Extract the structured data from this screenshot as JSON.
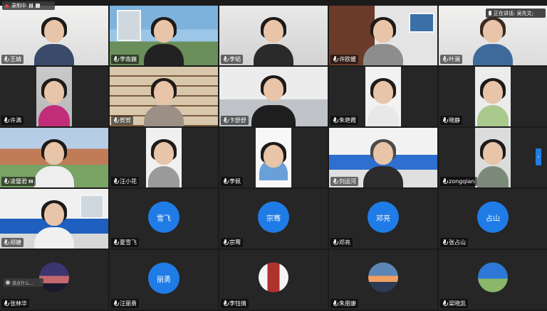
{
  "recording": {
    "label": "录制中"
  },
  "speaking": {
    "label": "正在讲话: 吴先文;"
  },
  "chat": {
    "placeholder": "说点什么..."
  },
  "colors": {
    "avatar_blue": "#1f7ce6",
    "background": "#1b1b1b"
  },
  "participants": [
    {
      "name": "王婧",
      "type": "video",
      "scene": "s-white"
    },
    {
      "name": "李南巍",
      "type": "video",
      "scene": "s-build"
    },
    {
      "name": "李韬",
      "type": "video",
      "scene": "s-white2"
    },
    {
      "name": "许欧媛",
      "type": "video",
      "scene": "s-book"
    },
    {
      "name": "叶澜",
      "type": "video",
      "scene": "s-white"
    },
    {
      "name": "许满",
      "type": "video",
      "scene": "s-center"
    },
    {
      "name": "贺贺",
      "type": "video",
      "scene": "s-shelf"
    },
    {
      "name": "卞舒舒",
      "type": "video",
      "scene": "s-office"
    },
    {
      "name": "朱艳霞",
      "type": "video",
      "scene": "s-center"
    },
    {
      "name": "晓静",
      "type": "video",
      "scene": "s-center"
    },
    {
      "name": "凌璧君",
      "type": "video",
      "scene": "s-campus"
    },
    {
      "name": "汪小花",
      "type": "video",
      "scene": "s-center"
    },
    {
      "name": "李佩",
      "type": "video",
      "scene": "s-center"
    },
    {
      "name": "刘运河",
      "type": "video",
      "scene": "s-meeting"
    },
    {
      "name": "zongqian",
      "type": "video",
      "scene": "s-center"
    },
    {
      "name": "郑婕",
      "type": "video",
      "scene": "s-room"
    },
    {
      "name": "夏雪飞",
      "type": "avatar",
      "avatar_text": "雪飞"
    },
    {
      "name": "宗骞",
      "type": "avatar",
      "avatar_text": "宗骞"
    },
    {
      "name": "邓亮",
      "type": "avatar",
      "avatar_text": "邓亮"
    },
    {
      "name": "张占山",
      "type": "avatar",
      "avatar_text": "占山"
    },
    {
      "name": "张林华",
      "type": "photo",
      "photo": "p-city"
    },
    {
      "name": "汪丽勇",
      "type": "avatar",
      "avatar_text": "丽勇"
    },
    {
      "name": "李钰倩",
      "type": "photo",
      "photo": "p-wine"
    },
    {
      "name": "朱朋康",
      "type": "photo",
      "photo": "p-sunset"
    },
    {
      "name": "梁晓凯",
      "type": "photo",
      "photo": "p-sky"
    }
  ]
}
